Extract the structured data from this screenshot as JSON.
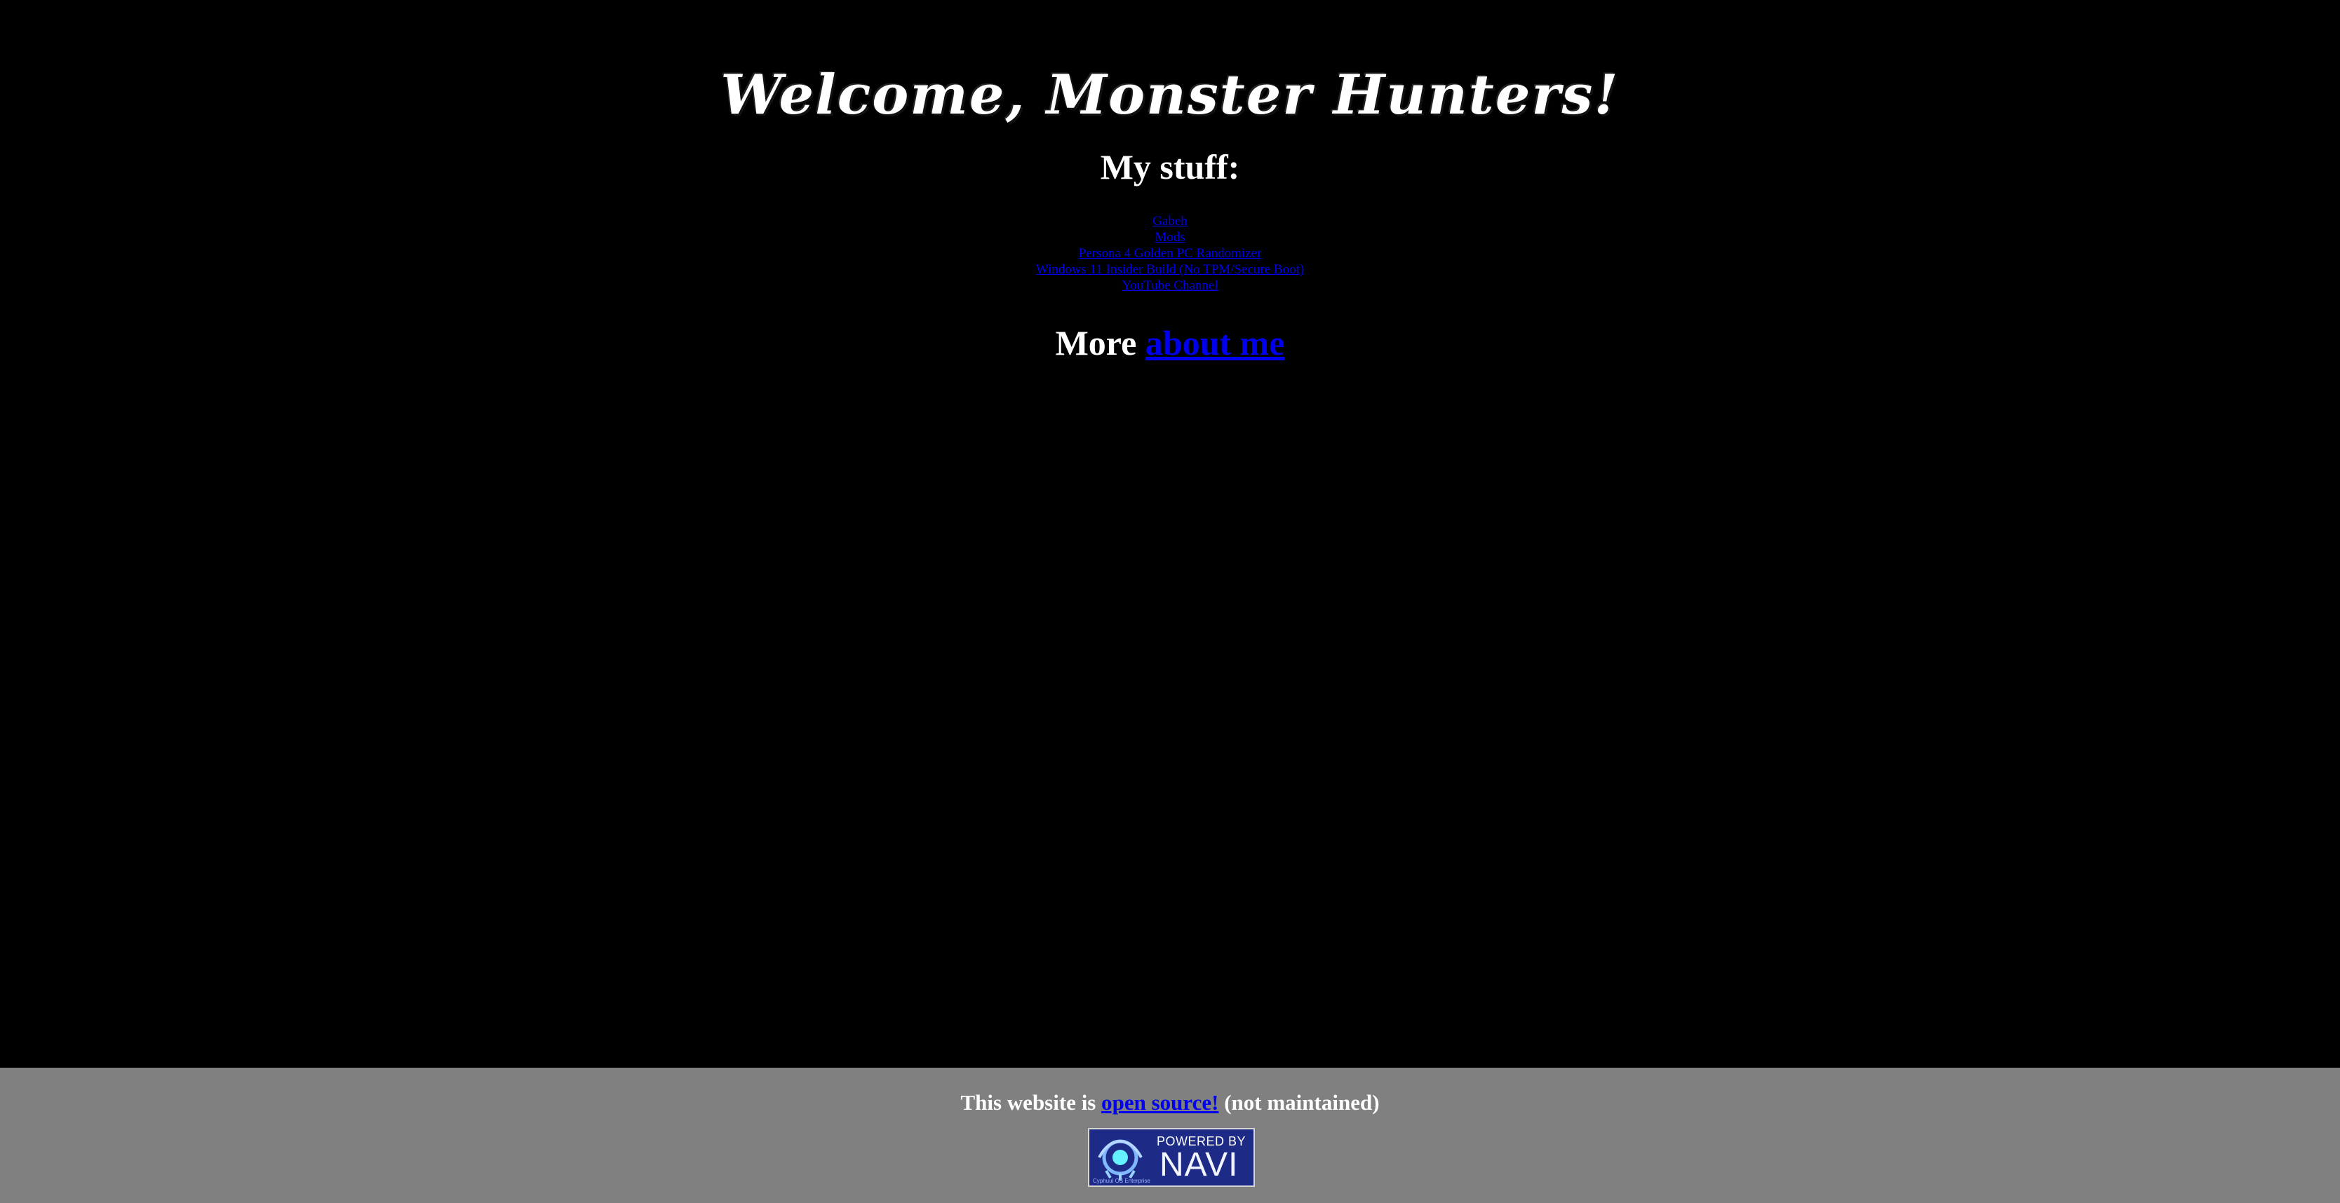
{
  "main": {
    "title": "Welcome, Monster Hunters!",
    "my_stuff_heading": "My stuff:",
    "links": [
      {
        "label": "Gabeh"
      },
      {
        "label": "Mods"
      },
      {
        "label": "Persona 4 Golden PC Randomizer"
      },
      {
        "label": "Windows 11 Insider Build (No TPM/Secure Boot)"
      },
      {
        "label": "YouTube Channel"
      }
    ],
    "more_prefix": "More",
    "about_link": "about me"
  },
  "footer": {
    "text_prefix": "This website is",
    "open_source_link": "open source!",
    "text_suffix": "(not maintained)",
    "badge": {
      "powered_by": "POWERED BY",
      "name": "NAVI",
      "tagline": "Cyphuul OS Enterprise"
    }
  },
  "colors": {
    "background": "#000000",
    "footer_background": "#808080",
    "text": "#ffffff",
    "link": "#0000ee",
    "badge_blue": "#1d2a86"
  }
}
